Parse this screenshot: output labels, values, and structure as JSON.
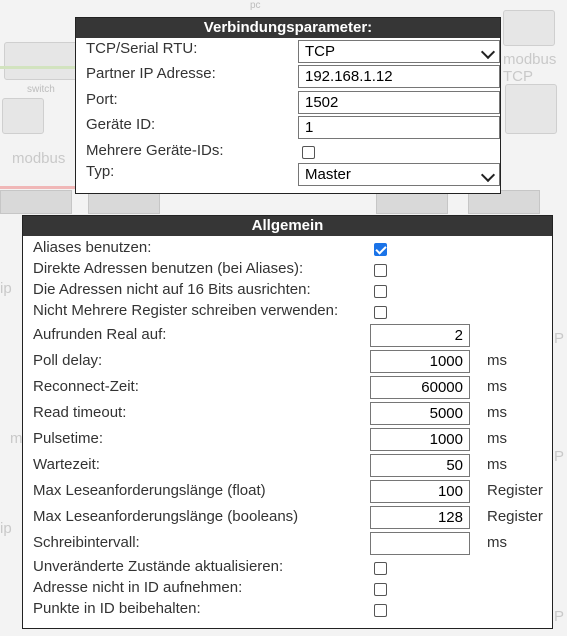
{
  "background": {
    "labels": [
      "switch",
      "pc",
      "modbus TCP",
      "modbus",
      "ip",
      "m",
      "P"
    ]
  },
  "connection": {
    "title": "Verbindungsparameter:",
    "type_label": "TCP/Serial RTU:",
    "type_value": "TCP",
    "ip_label": "Partner IP Adresse:",
    "ip_value": "192.168.1.12",
    "port_label": "Port:",
    "port_value": "1502",
    "device_id_label": "Geräte ID:",
    "device_id_value": "1",
    "multi_ids_label": "Mehrere Geräte-IDs:",
    "multi_ids_checked": false,
    "role_label": "Typ:",
    "role_value": "Master"
  },
  "general": {
    "title": "Allgemein",
    "use_aliases_label": "Aliases benutzen:",
    "use_aliases_checked": true,
    "direct_addresses_label": "Direkte Adressen benutzen (bei Aliases):",
    "direct_addresses_checked": false,
    "no_align_label": "Die Adressen nicht auf 16 Bits ausrichten:",
    "no_align_checked": false,
    "no_multi_write_label": "Nicht Mehrere Register schreiben verwenden:",
    "no_multi_write_checked": false,
    "round_real_label": "Aufrunden Real auf:",
    "round_real_value": "2",
    "poll_delay_label": "Poll delay:",
    "poll_delay_value": "1000",
    "poll_delay_unit": "ms",
    "reconnect_label": "Reconnect-Zeit:",
    "reconnect_value": "60000",
    "reconnect_unit": "ms",
    "read_timeout_label": "Read timeout:",
    "read_timeout_value": "5000",
    "read_timeout_unit": "ms",
    "pulsetime_label": "Pulsetime:",
    "pulsetime_value": "1000",
    "pulsetime_unit": "ms",
    "wait_label": "Wartezeit:",
    "wait_value": "50",
    "wait_unit": "ms",
    "max_float_label": "Max Leseanforderungslänge (float)",
    "max_float_value": "100",
    "max_float_unit": "Register",
    "max_bool_label": "Max Leseanforderungslänge (booleans)",
    "max_bool_value": "128",
    "max_bool_unit": "Register",
    "write_interval_label": "Schreibintervall:",
    "write_interval_value": "",
    "write_interval_unit": "ms",
    "update_unchanged_label": "Unveränderte Zustände aktualisieren:",
    "update_unchanged_checked": false,
    "address_not_in_id_label": "Adresse nicht in ID aufnehmen:",
    "address_not_in_id_checked": false,
    "keep_dots_label": "Punkte in ID beibehalten:",
    "keep_dots_checked": false
  }
}
